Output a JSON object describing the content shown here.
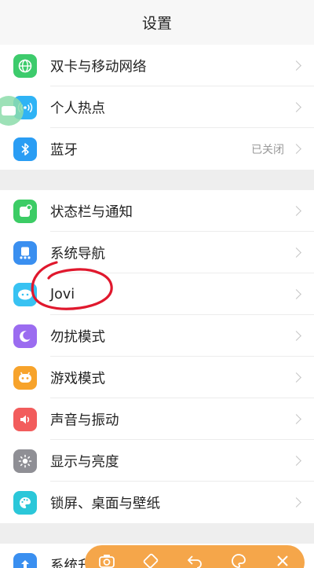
{
  "header": {
    "title": "设置"
  },
  "groups": [
    {
      "items": [
        {
          "id": "dual-sim",
          "label": "双卡与移动网络",
          "icon": "globe-icon",
          "color": "#3dcb6c"
        },
        {
          "id": "hotspot",
          "label": "个人热点",
          "icon": "hotspot-icon",
          "color": "#2fb3f5"
        },
        {
          "id": "bluetooth",
          "label": "蓝牙",
          "value": "已关闭",
          "icon": "bluetooth-icon",
          "color": "#2a9df4"
        }
      ]
    },
    {
      "items": [
        {
          "id": "status-bar",
          "label": "状态栏与通知",
          "icon": "notification-icon",
          "color": "#3ccc65"
        },
        {
          "id": "nav",
          "label": "系统导航",
          "icon": "navigation-icon",
          "color": "#3a8ff0"
        },
        {
          "id": "jovi",
          "label": "Jovi",
          "icon": "jovi-icon",
          "color": "#38c2f2"
        },
        {
          "id": "dnd",
          "label": "勿扰模式",
          "icon": "moon-icon",
          "color": "#9b6cf0"
        },
        {
          "id": "game",
          "label": "游戏模式",
          "icon": "game-icon",
          "color": "#f7a32b"
        },
        {
          "id": "sound",
          "label": "声音与振动",
          "icon": "speaker-icon",
          "color": "#f25c5c"
        },
        {
          "id": "display",
          "label": "显示与亮度",
          "icon": "brightness-icon",
          "color": "#8f8f95"
        },
        {
          "id": "wallpaper",
          "label": "锁屏、桌面与壁纸",
          "icon": "palette-icon",
          "color": "#2bc7d9"
        }
      ]
    },
    {
      "items": [
        {
          "id": "update",
          "label": "系统升级",
          "icon": "update-icon",
          "color": "#3a8ff0"
        }
      ]
    }
  ],
  "toolbar": {
    "color": "#f5a64a",
    "buttons": [
      "camera-icon",
      "eraser-icon",
      "undo-icon",
      "palette-icon",
      "close-icon"
    ]
  },
  "annotation": {
    "color": "#e0182d"
  }
}
